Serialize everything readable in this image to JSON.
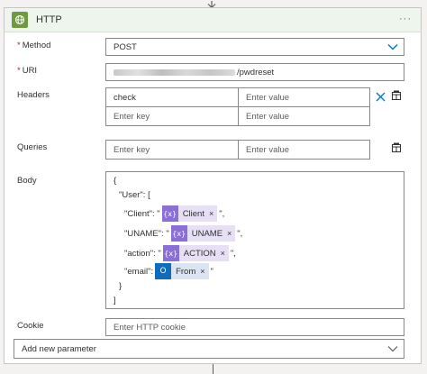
{
  "action": {
    "title": "HTTP",
    "more_glyph": "···"
  },
  "method": {
    "label": "Method",
    "required_mark": "*",
    "value": "POST"
  },
  "uri": {
    "label": "URI",
    "required_mark": "*",
    "value_suffix": "/pwdreset"
  },
  "headers": {
    "label": "Headers",
    "rows": [
      {
        "key": "check",
        "value_placeholder": "Enter value"
      },
      {
        "key_placeholder": "Enter key",
        "value_placeholder": "Enter value"
      }
    ]
  },
  "queries": {
    "label": "Queries",
    "key_placeholder": "Enter key",
    "value_placeholder": "Enter value"
  },
  "body": {
    "label": "Body",
    "open_brace": "{",
    "user_line": "\"User\": [",
    "inner_open": "{",
    "inner_close": "}",
    "array_close": "]",
    "close_brace": "}",
    "fields": [
      {
        "key": "\"Client\": \"",
        "token": "Client",
        "token_icon": "{x}",
        "suffix": "\","
      },
      {
        "key": "\"UNAME\": \"",
        "token": "UNAME",
        "token_icon": "{x}",
        "suffix": "\","
      },
      {
        "key": "\"action\": \"",
        "token": "ACTION",
        "token_icon": "{x}",
        "suffix": "\","
      },
      {
        "key": "\"email\": ",
        "token": "From",
        "token_icon": "O",
        "suffix": "\""
      }
    ],
    "token_close": "×"
  },
  "cookie": {
    "label": "Cookie",
    "placeholder": "Enter HTTP cookie"
  },
  "add_parameter": {
    "label": "Add new parameter"
  },
  "colors": {
    "header_bg": "#eef5ed",
    "http_icon": "#6d9a43",
    "accent": "#0078d4",
    "variable_token": "#8a6fd6",
    "outlook_token": "#0f6cbd",
    "required": "#a4262c"
  }
}
